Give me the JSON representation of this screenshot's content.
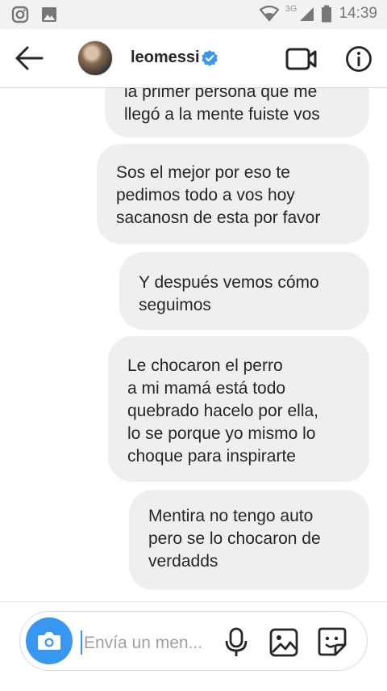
{
  "status_bar": {
    "network": "3G",
    "time": "14:39"
  },
  "header": {
    "username": "leomessi",
    "verified": true,
    "icons": [
      "back-arrow-icon",
      "video-call-icon",
      "info-icon"
    ]
  },
  "messages": [
    {
      "text": "la primer persona que me\nllegó a la mente fuiste vos"
    },
    {
      "text": "Sos el mejor por eso te\npedimos todo a vos  hoy\nsacanosn de esta por favor"
    },
    {
      "text": "Y después vemos cómo\nseguimos"
    },
    {
      "text": "Le chocaron el perro\na mi mamá está todo\nquebrado hacelo por ella,\nlo se porque yo mismo lo\nchoque para inspirarte"
    },
    {
      "text": "Mentira no tengo auto\npero se lo chocaron de\nverdadds"
    }
  ],
  "composer": {
    "placeholder": "Envía un men...",
    "accent_color": "#3897f0"
  }
}
